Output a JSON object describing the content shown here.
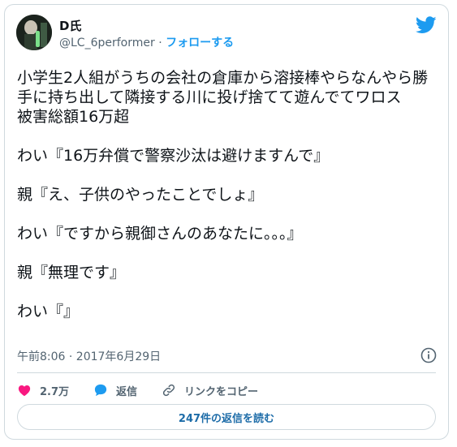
{
  "author": {
    "name": "D氏",
    "handle": "@LC_6performer",
    "separator": "·",
    "follow_label": "フォローする"
  },
  "tweet": {
    "text": "小学生2人組がうちの会社の倉庫から溶接棒やらなんやら勝手に持ち出して隣接する川に投げ捨てて遊んでてワロス\n被害総額16万超\n\nわい『16万弁償で警察沙汰は避けますんで』\n\n親『え、子供のやったことでしょ』\n\nわい『ですから親御さんのあなたに。。。』\n\n親『無理です』\n\nわい『』",
    "timestamp": "午前8:06 · 2017年6月29日"
  },
  "actions": {
    "likes_count": "2.7万",
    "reply_label": "返信",
    "copy_link_label": "リンクをコピー"
  },
  "read_replies_label": "247件の返信を読む",
  "icons": {
    "avatar": "avatar-photo",
    "logo": "twitter-bird-icon",
    "info": "info-icon",
    "like": "heart-icon",
    "reply": "speech-bubble-icon",
    "link": "link-icon"
  },
  "colors": {
    "twitter_blue": "#1d9bf0",
    "like_pink": "#f91880",
    "text": "#0f1419",
    "muted": "#536471",
    "border": "#cfd9de"
  }
}
